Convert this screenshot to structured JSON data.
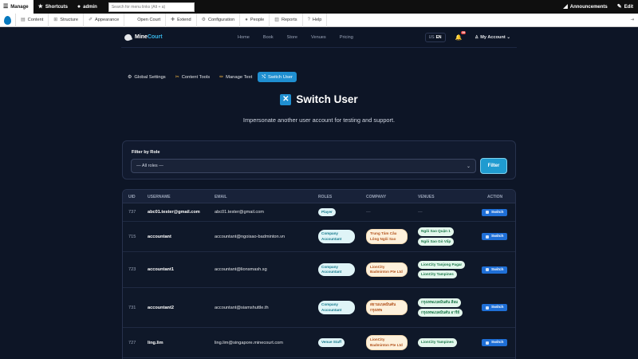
{
  "toolbar": {
    "manage": "Manage",
    "shortcuts": "Shortcuts",
    "user": "admin",
    "search_placeholder": "Search for menu links (Alt + a)",
    "announcements": "Announcements",
    "edit": "Edit"
  },
  "admin_menu": [
    "Content",
    "Structure",
    "Appearance",
    "Open Court",
    "Extend",
    "Configuration",
    "People",
    "Reports",
    "Help"
  ],
  "site": {
    "brand_a": "Mine",
    "brand_b": "Court",
    "nav": [
      "Home",
      "Book",
      "Store",
      "Venues",
      "Pricing"
    ],
    "lang_flag": "US",
    "lang": "EN",
    "notif_count": "99",
    "account": "My Account"
  },
  "tabs": [
    "Global Settings",
    "Content Tools",
    "Manage Text",
    "Switch User"
  ],
  "page": {
    "title": "Switch User",
    "subtitle": "Impersonate another user account for testing and support."
  },
  "filter": {
    "label": "Filter by Role",
    "selected": "— All roles —",
    "button": "Filter"
  },
  "table": {
    "headers": [
      "UID",
      "USERNAME",
      "EMAIL",
      "ROLES",
      "COMPANY",
      "VENUES",
      "ACTION"
    ],
    "action_label": "Switch",
    "rows": [
      {
        "uid": "737",
        "username": "abc01.tester@gmail.com",
        "email": "abc01.tester@gmail.com",
        "role": "Player",
        "company": "—",
        "venues": [
          "—"
        ]
      },
      {
        "uid": "715",
        "username": "accountant",
        "email": "accountant@ngoisao-badminton.vn",
        "role": "Company Accountant",
        "company": "Trung Tâm Cầu Lông Ngôi Sao",
        "venues": [
          "Ngôi Sao Quận 1",
          "Ngôi Sao Gò Vấp"
        ]
      },
      {
        "uid": "723",
        "username": "accountant1",
        "email": "accountant@lionsmash.sg",
        "role": "Company Accountant",
        "company": "LionCity Badminton Pte Ltd",
        "venues": [
          "LionCity Tanjong Pagar",
          "LionCity Tampines"
        ]
      },
      {
        "uid": "731",
        "username": "accountant2",
        "email": "accountant@siamshuttle.th",
        "role": "Company Accountant",
        "company": "สยามแบดมินตัน กรุงเทพ",
        "venues": [
          "กรุงเทพแบดมินตัน สีลม",
          "กรุงเทพแบดมินตัน อารีย์"
        ]
      },
      {
        "uid": "727",
        "username": "ling.lim",
        "email": "ling.lim@singapore.minecourt.com",
        "role": "Venue Staff",
        "company": "LionCity Badminton Pte Ltd",
        "venues": [
          "LionCity Tampines"
        ]
      }
    ]
  }
}
